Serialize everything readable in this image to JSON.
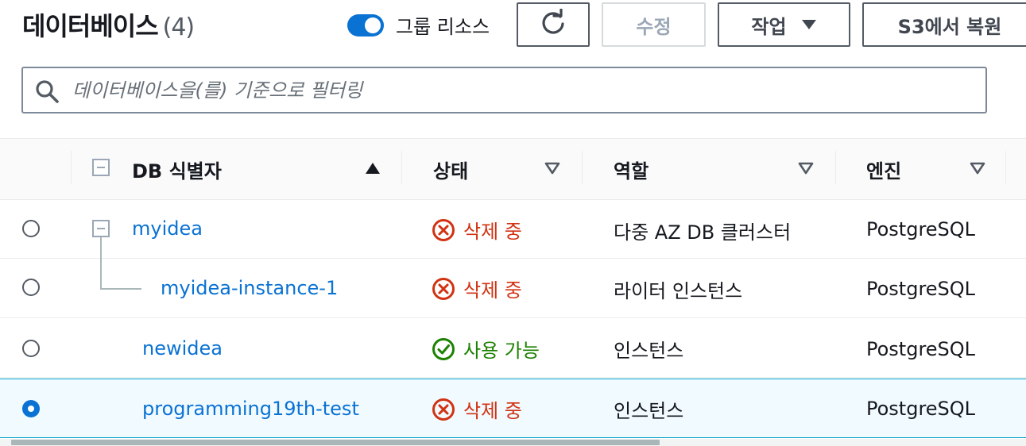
{
  "header": {
    "title": "데이터베이스",
    "count": "(4)",
    "group_resources_label": "그룹 리소스",
    "group_resources_on": true,
    "edit_label": "수정",
    "actions_label": "작업",
    "restore_label": "S3에서 복원"
  },
  "search": {
    "placeholder": "데이터베이스을(를) 기준으로 필터링",
    "value": ""
  },
  "table": {
    "columns": [
      "DB 식별자",
      "상태",
      "역할",
      "엔진"
    ],
    "rows": [
      {
        "id": "myidea",
        "status": "삭제 중",
        "role": "다중 AZ DB 클러스터",
        "engine": "PostgreSQL"
      },
      {
        "id": "myidea-instance-1",
        "status": "삭제 중",
        "role": "라이터 인스턴스",
        "engine": "PostgreSQL"
      },
      {
        "id": "newidea",
        "status": "사용 가능",
        "role": "인스턴스",
        "engine": "PostgreSQL"
      },
      {
        "id": "programming19th-test",
        "status": "삭제 중",
        "role": "인스턴스",
        "engine": "PostgreSQL"
      }
    ]
  },
  "colors": {
    "accent": "#0972d3",
    "status_deleting": "#d13212",
    "status_available": "#1d8102"
  },
  "icons": [
    "refresh-icon",
    "caret-down-icon",
    "search-icon",
    "sort-ascending-icon",
    "sort-icon",
    "error-circle-icon",
    "check-circle-icon"
  ]
}
